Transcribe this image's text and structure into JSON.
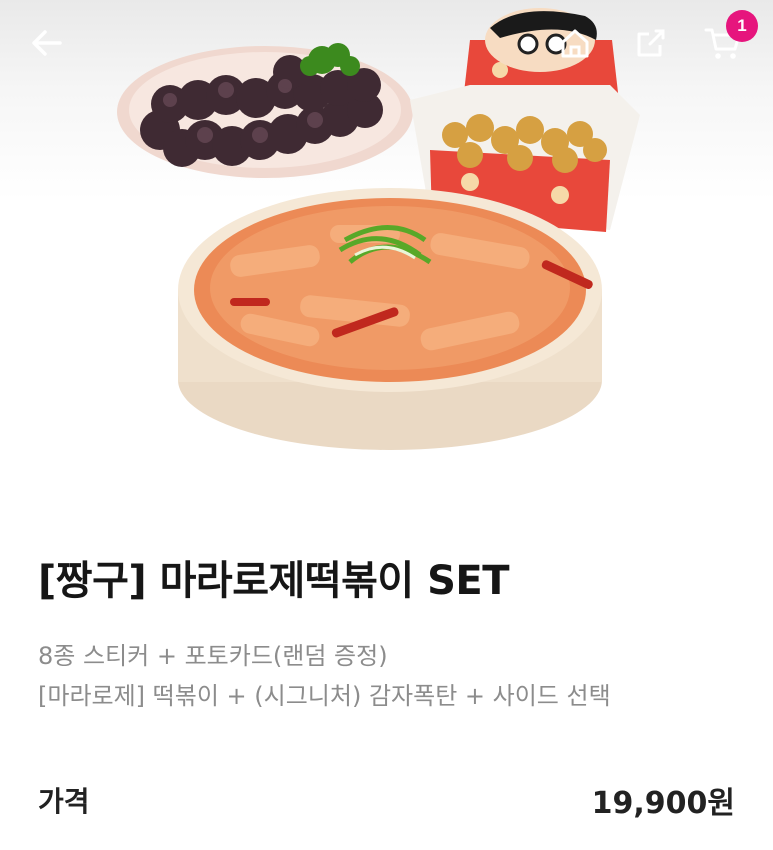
{
  "header": {
    "back_icon": "arrow-left-icon",
    "home_icon": "home-icon",
    "share_icon": "share-icon",
    "cart_icon": "cart-icon",
    "cart_count": "1",
    "badge_color": "#e6157d"
  },
  "product": {
    "title": "[짱구] 마라로제떡볶이 SET",
    "description_line1": "8종 스티커 + 포토카드(랜덤 증정)",
    "description_line2": "[마라로제] 떡볶이 + (시그니처) 감자폭탄 + 사이드 선택",
    "price_label": "가격",
    "price_value": "19,900원"
  }
}
